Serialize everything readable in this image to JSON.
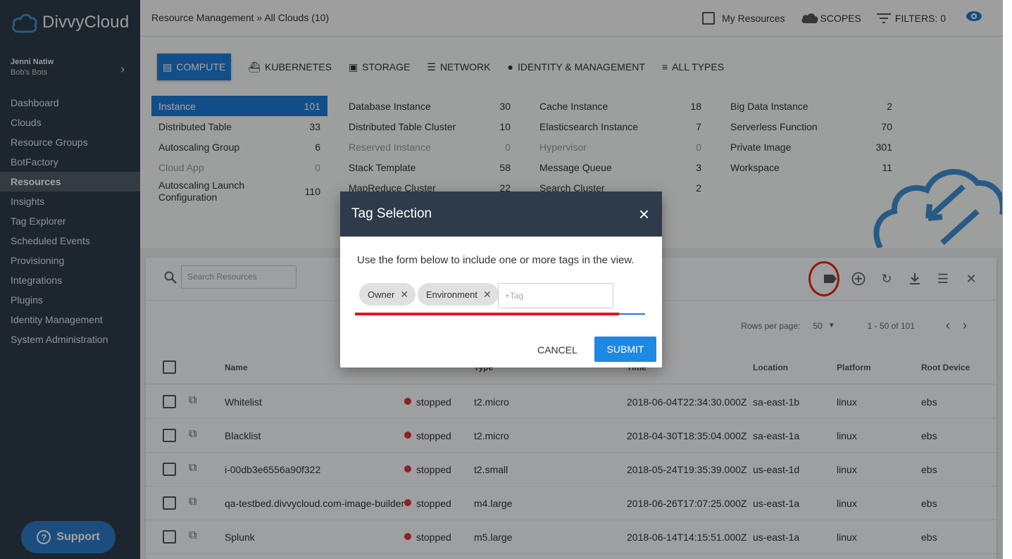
{
  "app": {
    "name": "DivvyCloud"
  },
  "user": {
    "name": "Jenni Natiw",
    "org": "Bob's Bots"
  },
  "sidebar": {
    "items": [
      {
        "label": "Dashboard"
      },
      {
        "label": "Clouds"
      },
      {
        "label": "Resource Groups"
      },
      {
        "label": "BotFactory"
      },
      {
        "label": "Resources",
        "active": true
      },
      {
        "label": "Insights"
      },
      {
        "label": "Tag Explorer"
      },
      {
        "label": "Scheduled Events"
      },
      {
        "label": "Provisioning"
      },
      {
        "label": "Integrations"
      },
      {
        "label": "Plugins"
      },
      {
        "label": "Identity Management"
      },
      {
        "label": "System Administration"
      }
    ],
    "support_label": "Support"
  },
  "header": {
    "breadcrumb": "Resource Management » All Clouds (10)",
    "my_resources": "My Resources",
    "scopes": "SCOPES",
    "filters": "FILTERS: 0"
  },
  "type_tabs": [
    {
      "label": "COMPUTE",
      "icon": "server-icon",
      "active": true
    },
    {
      "label": "KUBERNETES",
      "icon": "docker-icon"
    },
    {
      "label": "STORAGE",
      "icon": "disk-icon"
    },
    {
      "label": "NETWORK",
      "icon": "network-icon"
    },
    {
      "label": "IDENTITY & MANAGEMENT",
      "icon": "person-icon"
    },
    {
      "label": "ALL TYPES",
      "icon": "list-icon"
    }
  ],
  "resource_types": [
    [
      {
        "name": "Instance",
        "count": "101",
        "selected": true
      },
      {
        "name": "Distributed Table",
        "count": "33"
      },
      {
        "name": "Autoscaling Group",
        "count": "6"
      },
      {
        "name": "Cloud App",
        "count": "0",
        "disabled": true
      },
      {
        "name": "Autoscaling Launch Configuration",
        "count": "110"
      }
    ],
    [
      {
        "name": "Database Instance",
        "count": "30"
      },
      {
        "name": "Distributed Table Cluster",
        "count": "10"
      },
      {
        "name": "Reserved Instance",
        "count": "0",
        "disabled": true
      },
      {
        "name": "Stack Template",
        "count": "58"
      },
      {
        "name": "MapReduce Cluster",
        "count": "22"
      }
    ],
    [
      {
        "name": "Cache Instance",
        "count": "18"
      },
      {
        "name": "Elasticsearch Instance",
        "count": "7"
      },
      {
        "name": "Hypervisor",
        "count": "0",
        "disabled": true
      },
      {
        "name": "Message Queue",
        "count": "3"
      },
      {
        "name": "Search Cluster",
        "count": "2"
      }
    ],
    [
      {
        "name": "Big Data Instance",
        "count": "2"
      },
      {
        "name": "Serverless Function",
        "count": "70"
      },
      {
        "name": "Private Image",
        "count": "301"
      },
      {
        "name": "Workspace",
        "count": "11"
      }
    ]
  ],
  "search": {
    "placeholder": "Search Resources"
  },
  "pager": {
    "rows_per_page_label": "Rows per page:",
    "rows_per_page": "50",
    "range": "1 - 50 of 101"
  },
  "table": {
    "columns": [
      "Name",
      "",
      "Type",
      "Time",
      "Location",
      "Platform",
      "Root Device"
    ],
    "rows": [
      {
        "name": "Whitelist",
        "state": "stopped",
        "type": "t2.micro",
        "time": "2018-06-04T22:34:30.000Z",
        "location": "sa-east-1b",
        "platform": "linux",
        "root": "ebs"
      },
      {
        "name": "Blacklist",
        "state": "stopped",
        "type": "t2.micro",
        "time": "2018-04-30T18:35:04.000Z",
        "location": "sa-east-1a",
        "platform": "linux",
        "root": "ebs"
      },
      {
        "name": "i-00db3e6556a90f322",
        "state": "stopped",
        "type": "t2.small",
        "time": "2018-05-24T19:35:39.000Z",
        "location": "us-east-1d",
        "platform": "linux",
        "root": "ebs"
      },
      {
        "name": "qa-testbed.divvycloud.com-image-builder",
        "state": "stopped",
        "type": "m4.large",
        "time": "2018-06-26T17:07:25.000Z",
        "location": "us-east-1a",
        "platform": "linux",
        "root": "ebs"
      },
      {
        "name": "Splunk",
        "state": "stopped",
        "type": "m5.large",
        "time": "2018-06-14T14:15:51.000Z",
        "location": "us-east-1a",
        "platform": "linux",
        "root": "ebs"
      }
    ]
  },
  "modal": {
    "title": "Tag Selection",
    "description": "Use the form below to include one or more tags in the view.",
    "chips": [
      "Owner",
      "Environment"
    ],
    "tag_placeholder": "+Tag",
    "cancel": "CANCEL",
    "submit": "SUBMIT"
  },
  "colors": {
    "accent": "#1e7bd6",
    "sidebar": "#2e3b48",
    "annotation_red": "#e8141e",
    "status_stopped": "#d9363e"
  }
}
